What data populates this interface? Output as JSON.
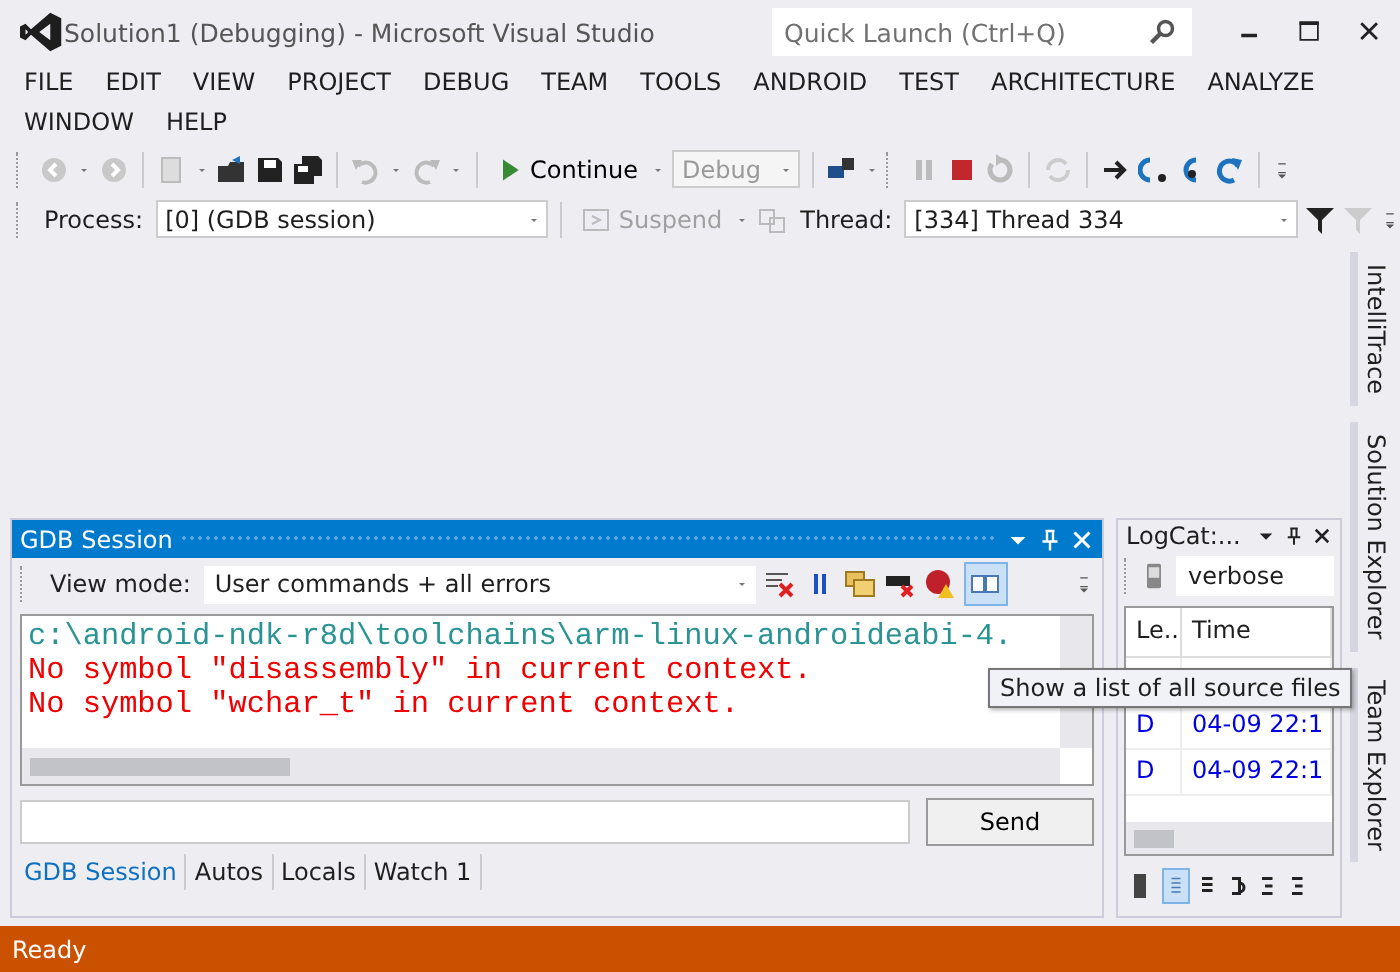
{
  "window": {
    "title": "Solution1 (Debugging) - Microsoft Visual Studio"
  },
  "quick_launch": {
    "placeholder": "Quick Launch (Ctrl+Q)"
  },
  "menu": [
    "FILE",
    "EDIT",
    "VIEW",
    "PROJECT",
    "DEBUG",
    "TEAM",
    "TOOLS",
    "ANDROID",
    "TEST",
    "ARCHITECTURE",
    "ANALYZE",
    "WINDOW",
    "HELP"
  ],
  "debug_toolbar": {
    "continue": "Continue",
    "configuration": {
      "value": "Debug",
      "disabled": true
    }
  },
  "location_toolbar": {
    "process_label": "Process:",
    "process": "[0] (GDB session)",
    "suspend": {
      "label": "Suspend",
      "disabled": true
    },
    "thread_label": "Thread:",
    "thread": "[334] Thread 334"
  },
  "gdb_panel": {
    "title": "GDB Session",
    "view_mode_label": "View mode:",
    "view_mode": "User commands + all errors",
    "output": [
      {
        "kind": "info",
        "text": "c:\\android-ndk-r8d\\toolchains\\arm-linux-androideabi-4."
      },
      {
        "kind": "error",
        "text": "No symbol \"disassembly\" in current context."
      },
      {
        "kind": "error",
        "text": "No symbol \"wchar_t\" in current context."
      }
    ],
    "send": "Send",
    "tabs": [
      {
        "label": "GDB Session",
        "selected": true
      },
      {
        "label": "Autos",
        "selected": false
      },
      {
        "label": "Locals",
        "selected": false
      },
      {
        "label": "Watch 1",
        "selected": false
      }
    ]
  },
  "tooltip": "Show a list of all source files",
  "logcat_panel": {
    "title": "LogCat:...",
    "filter": "verbose",
    "columns": [
      "Le...",
      "Time"
    ],
    "rows": [
      {
        "level": "D",
        "time": "04-09 22:1"
      },
      {
        "level": "D",
        "time": "04-09 22:1"
      }
    ]
  },
  "side_tabs": [
    "IntelliTrace",
    "Solution Explorer",
    "Team Explorer"
  ],
  "status_bar": {
    "text": "Ready"
  }
}
